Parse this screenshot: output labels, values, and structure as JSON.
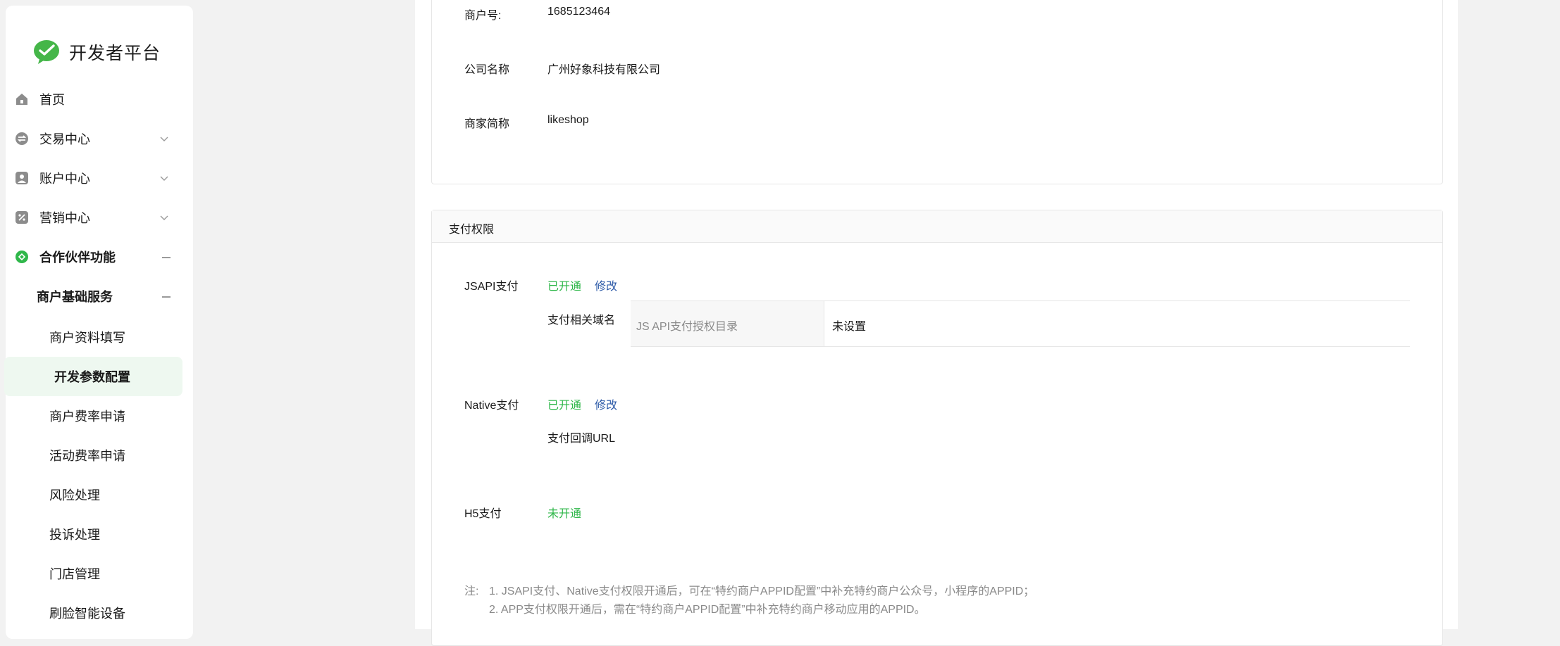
{
  "sidebar": {
    "brand": "开发者平台",
    "items": [
      {
        "label": "首页",
        "icon": "home-icon"
      },
      {
        "label": "交易中心",
        "icon": "exchange-icon"
      },
      {
        "label": "账户中心",
        "icon": "account-icon"
      },
      {
        "label": "营销中心",
        "icon": "discount-icon"
      },
      {
        "label": "合作伙伴功能",
        "icon": "partner-icon"
      }
    ],
    "group": "商户基础服务",
    "subitems": [
      "商户资料填写",
      "开发参数配置",
      "商户费率申请",
      "活动费率申请",
      "风险处理",
      "投诉处理",
      "门店管理",
      "刷脸智能设备"
    ]
  },
  "info": {
    "merchant_no_label": "商户号:",
    "merchant_no_value": "1685123464",
    "company_label": "公司名称",
    "company_value": "广州好象科技有限公司",
    "short_name_label": "商家简称",
    "short_name_value": "likeshop"
  },
  "pay": {
    "title": "支付权限",
    "jsapi_label": "JSAPI支付",
    "jsapi_status": "已开通",
    "jsapi_edit": "修改",
    "domain_label": "支付相关域名",
    "domain_key": "JS API支付授权目录",
    "domain_value": "未设置",
    "native_label": "Native支付",
    "native_status": "已开通",
    "native_edit": "修改",
    "callback_label": "支付回调URL",
    "h5_label": "H5支付",
    "h5_status": "未开通",
    "note_prefix": "注:",
    "note_1": "1. JSAPI支付、Native支付权限开通后，可在“特约商户APPID配置”中补充特约商户公众号，小程序的APPID；",
    "note_2": "2. APP支付权限开通后，需在“特约商户APPID配置”中补充特约商户移动应用的APPID。"
  },
  "colors": {
    "accent": "#2fb74a",
    "link": "#2e5ba8",
    "active_bg": "#eef8f0"
  }
}
